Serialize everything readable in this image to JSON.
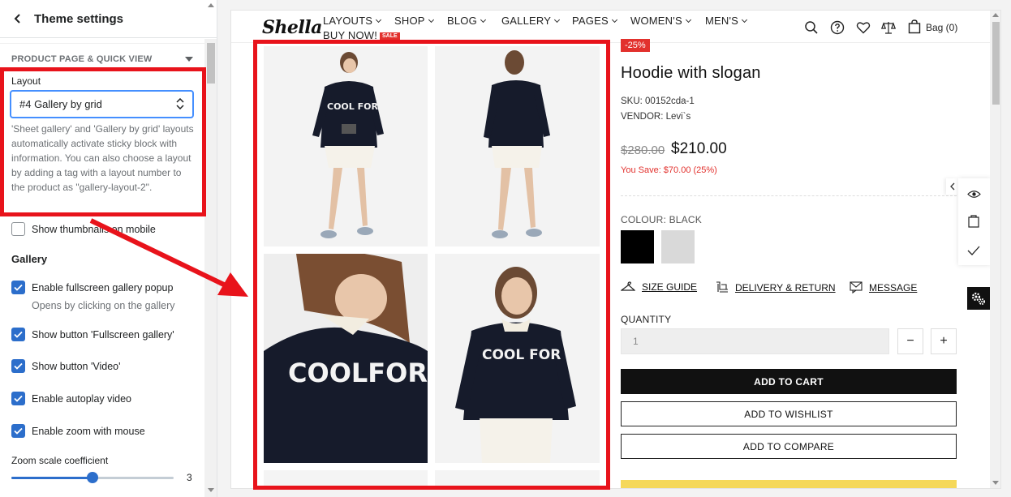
{
  "panel": {
    "back_label": "Theme settings",
    "section_title": "PRODUCT PAGE & QUICK VIEW",
    "layout_label": "Layout",
    "layout_value": "#4 Gallery by grid",
    "help_text": "'Sheet gallery' and 'Gallery by grid' layouts automatically activate sticky block with information. You can also choose a layout by adding a tag with a layout number to the product as \"gallery-layout-2\".",
    "show_thumbnails": {
      "label": "Show thumbnails on mobile",
      "checked": false
    },
    "gallery_title": "Gallery",
    "options": [
      {
        "label": "Enable fullscreen gallery popup",
        "checked": true,
        "note": "Opens by clicking on the gallery"
      },
      {
        "label": "Show button 'Fullscreen gallery'",
        "checked": true
      },
      {
        "label": "Show button 'Video'",
        "checked": true
      },
      {
        "label": "Enable autoplay video",
        "checked": true
      },
      {
        "label": "Enable zoom with mouse",
        "checked": true
      }
    ],
    "zoom": {
      "label": "Zoom scale coefficient",
      "value": "3",
      "fraction": 0.5
    }
  },
  "store": {
    "logo": "Shella",
    "menu": [
      {
        "label": "LAYOUTS",
        "dropdown": true
      },
      {
        "label": "SHOP",
        "dropdown": true
      },
      {
        "label": "BLOG",
        "dropdown": true
      },
      {
        "label": "GALLERY",
        "dropdown": true
      },
      {
        "label": "PAGES",
        "dropdown": true
      },
      {
        "label": "WOMEN'S",
        "dropdown": true
      },
      {
        "label": "MEN'S",
        "dropdown": true
      },
      {
        "label": "BUY NOW!",
        "dropdown": false
      }
    ],
    "sale_badge": "SALE",
    "bag_label": "Bag (0)",
    "icons": [
      "search-icon",
      "help-icon",
      "heart-icon",
      "compare-icon",
      "bag-icon"
    ]
  },
  "product": {
    "discount": "-25%",
    "title": "Hoodie with slogan",
    "sku": "SKU: 00152cda-1",
    "vendor": "VENDOR: Levi`s",
    "old_price": "$280.00",
    "price": "$210.00",
    "you_save": "You Save: $70.00 (25%)",
    "colour_label": "COLOUR: BLACK",
    "swatch_colors": [
      "#000000",
      "#d9d9d9"
    ],
    "links": {
      "size_guide": "SIZE GUIDE",
      "delivery": "DELIVERY & RETURN",
      "message": "MESSAGE"
    },
    "quantity_label": "QUANTITY",
    "quantity_value": "1",
    "qty_minus": "−",
    "qty_plus": "+",
    "add_to_cart": "ADD TO CART",
    "add_to_wishlist": "ADD TO WISHLIST",
    "add_to_compare": "ADD TO COMPARE",
    "photo_text": "COOL FOR"
  },
  "colors": {
    "accent": "#2c6ecb",
    "annotation": "#e8131b",
    "sale": "#e2312d",
    "focus": "#458fff"
  }
}
